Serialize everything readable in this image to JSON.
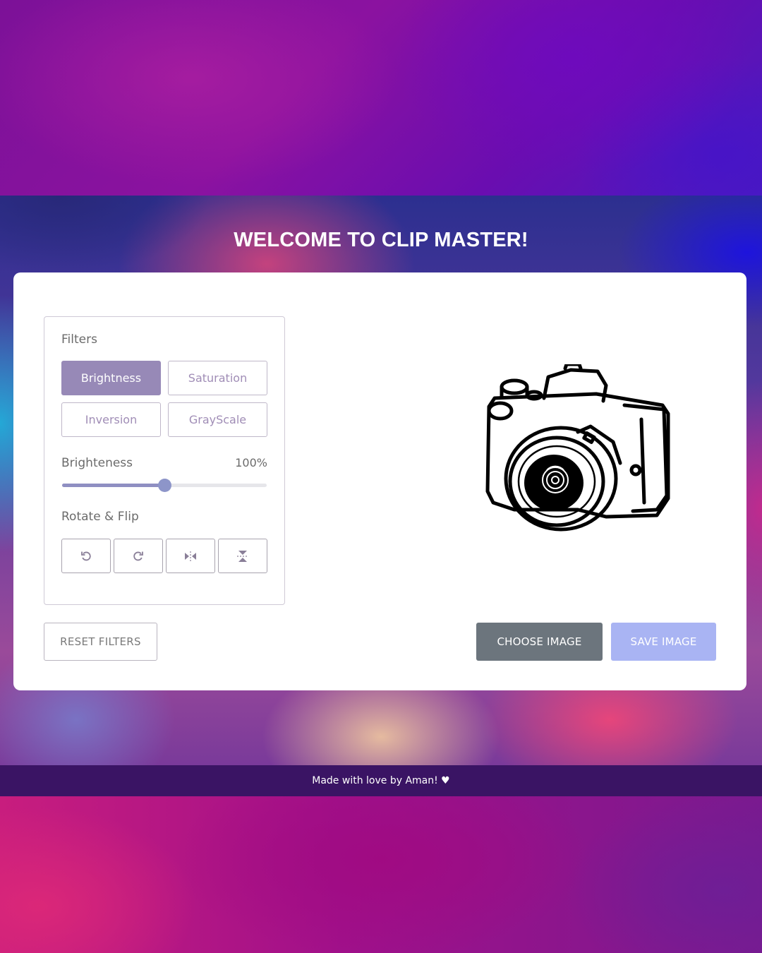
{
  "page": {
    "title": "WELCOME TO CLIP MASTER!"
  },
  "filters": {
    "heading": "Filters",
    "options": [
      {
        "label": "Brightness",
        "active": true
      },
      {
        "label": "Saturation",
        "active": false
      },
      {
        "label": "Inversion",
        "active": false
      },
      {
        "label": "GrayScale",
        "active": false
      }
    ],
    "slider": {
      "label": "Brighteness",
      "value_text": "100%",
      "value_fraction": 0.5
    }
  },
  "rotate_flip": {
    "heading": "Rotate & Flip",
    "buttons": [
      {
        "icon": "rotate-left-icon"
      },
      {
        "icon": "rotate-right-icon"
      },
      {
        "icon": "flip-horizontal-icon"
      },
      {
        "icon": "flip-vertical-icon"
      }
    ]
  },
  "actions": {
    "reset_label": "RESET FILTERS",
    "choose_label": "CHOOSE IMAGE",
    "save_label": "SAVE IMAGE"
  },
  "preview": {
    "icon": "camera-placeholder-icon"
  },
  "footer": {
    "text": "Made with love by Aman! ♥"
  },
  "colors": {
    "active_filter": "#9789b7",
    "filter_text": "#a08db6",
    "choose_button": "#6c757d",
    "save_button": "#a9b4f3",
    "footer_bg": "#3a1464"
  }
}
